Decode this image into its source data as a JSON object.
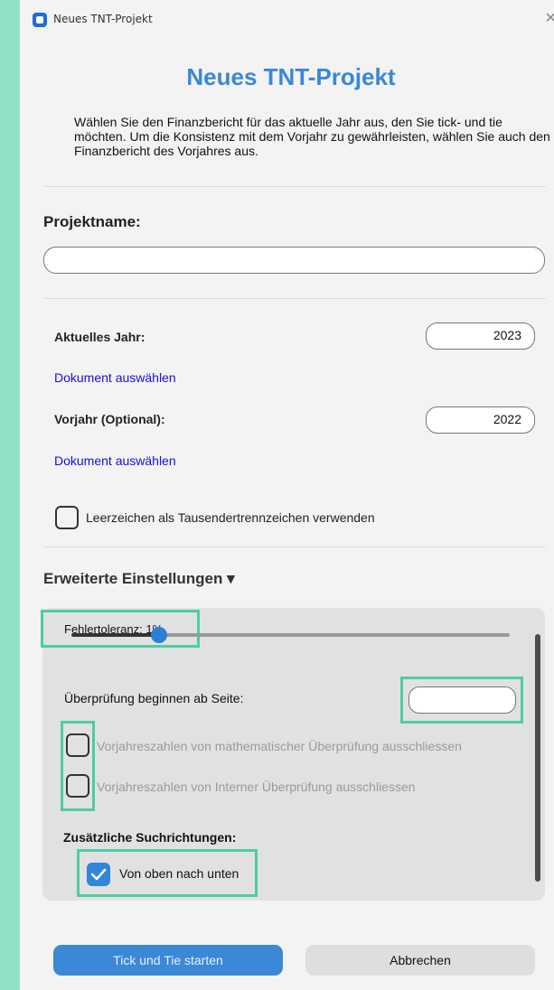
{
  "window": {
    "title": "Neues TNT-Projekt",
    "close_glyph": "✕"
  },
  "dialog": {
    "heading": "Neues TNT-Projekt",
    "intro": "Wählen Sie den Finanzbericht für das aktuelle Jahr aus, den Sie tick- und tie möchten. Um die Konsistenz mit dem Vorjahr zu gewährleisten, wählen Sie auch den Finanzbericht des Vorjahres aus."
  },
  "project": {
    "label": "Projektname:",
    "value": ""
  },
  "current_year": {
    "label": "Aktuelles Jahr:",
    "value": "2023",
    "link": "Dokument auswählen"
  },
  "previous_year": {
    "label": "Vorjahr (Optional):",
    "value": "2022",
    "link": "Dokument auswählen"
  },
  "thousand_separator": {
    "label": "Leerzeichen als Tausendertrennzeichen verwenden",
    "checked": false
  },
  "advanced": {
    "title": "Erweiterte Einstellungen ▾",
    "tolerance_label": "Fehlertoleranz: 1%",
    "tolerance_fraction": 0.2,
    "start_page_label": "Überprüfung beginnen ab Seite:",
    "start_page_value": "",
    "exclude_math_label": "Vorjahreszahlen von mathematischer Überprüfung ausschliessen",
    "exclude_internal_label": "Vorjahreszahlen von Interner Überprüfung ausschliessen",
    "directions_title": "Zusätzliche Suchrichtungen:",
    "top_to_bottom_label": "Von oben nach unten",
    "top_to_bottom_checked": true
  },
  "buttons": {
    "start": "Tick und Tie starten",
    "cancel": "Abbrechen"
  },
  "colors": {
    "accent": "#3a88d6",
    "highlight": "#4fcca1",
    "link": "#1a0dd8",
    "background": "#8fe2c7"
  }
}
